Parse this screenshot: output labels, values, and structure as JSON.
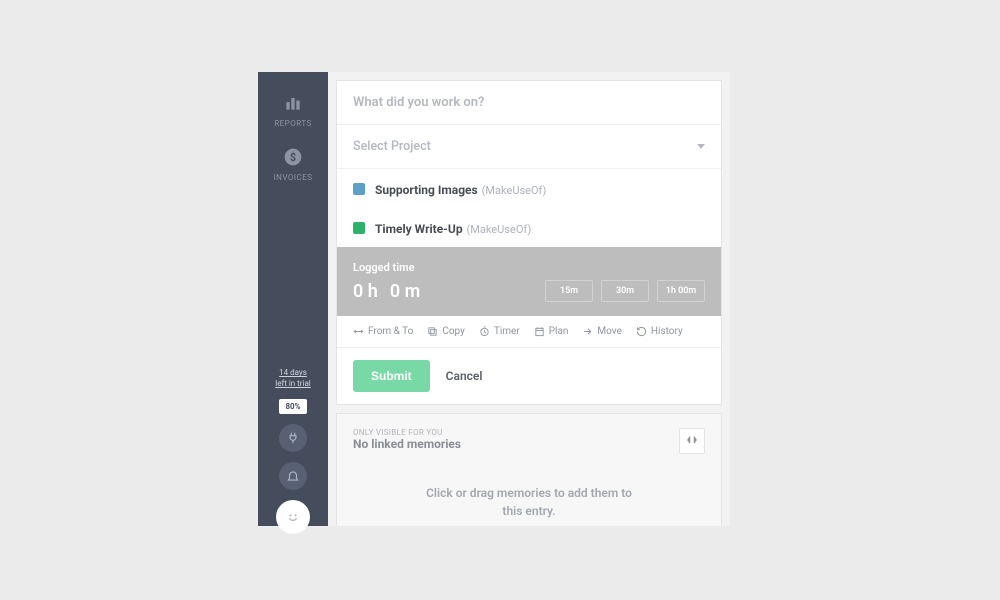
{
  "sidebar": {
    "items": [
      {
        "label": "REPORTS",
        "icon": "bar-chart-icon"
      },
      {
        "label": "INVOICES",
        "icon": "dollar-circle-icon"
      }
    ],
    "trial_line1": "14 days",
    "trial_line2": "left in trial",
    "pct_badge": "80%"
  },
  "entry": {
    "task_placeholder": "What did you work on?",
    "select_project_label": "Select Project",
    "projects": [
      {
        "name": "Supporting Images",
        "client": "(MakeUseOf)",
        "color": "#5e9fc5"
      },
      {
        "name": "Timely Write-Up",
        "client": "(MakeUseOf)",
        "color": "#2db26a"
      }
    ],
    "logged_label": "Logged time",
    "logged_hours": "0 h",
    "logged_minutes": "0 m",
    "quick": [
      "15m",
      "30m",
      "1h 00m"
    ],
    "actions": {
      "from_to": "From & To",
      "copy": "Copy",
      "timer": "Timer",
      "plan": "Plan",
      "move": "Move",
      "history": "History"
    },
    "submit": "Submit",
    "cancel": "Cancel"
  },
  "memories": {
    "eyebrow": "ONLY VISIBLE FOR YOU",
    "title": "No linked memories",
    "empty_line1": "Click or drag memories to add them to",
    "empty_line2": "this entry."
  }
}
